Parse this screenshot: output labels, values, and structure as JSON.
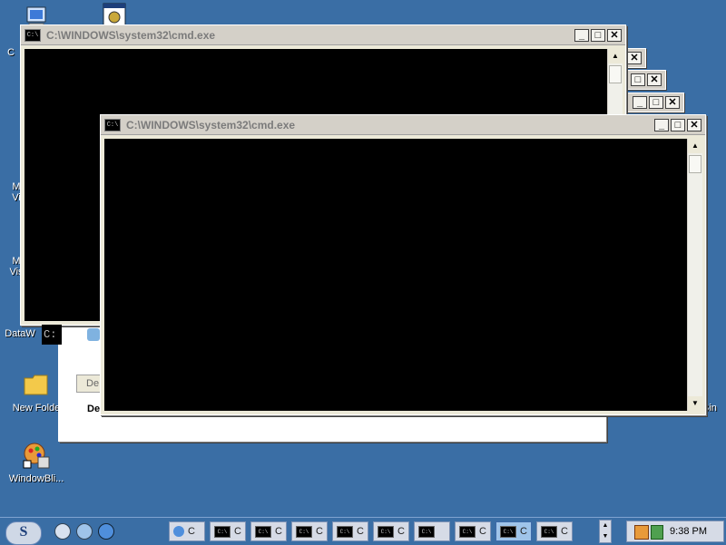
{
  "desktop": {
    "icons": [
      {
        "label": "C",
        "icon": "my-computer-icon"
      },
      {
        "label": "",
        "icon": "program-icon"
      },
      {
        "label": "M\nVi",
        "icon": "program-icon"
      },
      {
        "label": "M\nVis",
        "icon": "program-icon"
      },
      {
        "label": "DataW",
        "icon": "program-icon"
      },
      {
        "label": "New Folde",
        "icon": "folder-icon"
      },
      {
        "label": "WindowBli...",
        "icon": "windowblinds-icon"
      },
      {
        "label": "Bin",
        "icon": "recycle-bin-icon"
      }
    ]
  },
  "windows": {
    "back": {
      "title": "C:\\WINDOWS\\system32\\cmd.exe"
    },
    "front": {
      "title": "C:\\WINDOWS\\system32\\cmd.exe"
    },
    "controls": {
      "minimize": "_",
      "maximize": "□",
      "close": "✕"
    },
    "app_icon_text": "C:\\",
    "console_prompt_fragment": "C:"
  },
  "partial_window": {
    "button_label": "De",
    "text": "De"
  },
  "taskbar": {
    "start_label": "S",
    "tasks": [
      {
        "label": "C",
        "active": false
      },
      {
        "label": "C",
        "active": false
      },
      {
        "label": "C",
        "active": false
      },
      {
        "label": "C",
        "active": false
      },
      {
        "label": "C",
        "active": false
      },
      {
        "label": "C",
        "active": false
      },
      {
        "label": "",
        "active": false
      },
      {
        "label": "C",
        "active": false
      },
      {
        "label": "C",
        "active": true
      },
      {
        "label": "C",
        "active": false
      }
    ],
    "clock": "9:38 PM"
  },
  "colors": {
    "desktop": "#3a6ea5",
    "console": "#000000",
    "titlebar_inactive": "#d4d0c8"
  }
}
